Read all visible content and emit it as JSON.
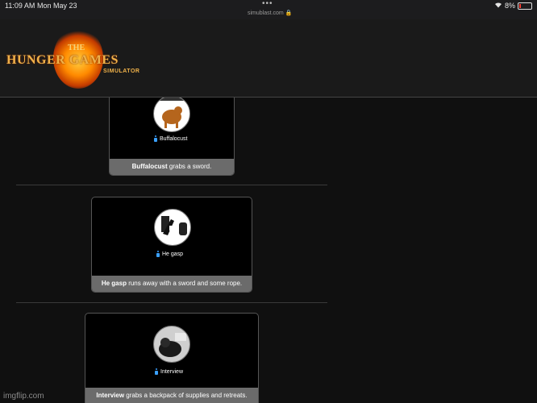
{
  "status_bar": {
    "time": "11:09 AM",
    "date": "Mon May 23",
    "url": "simublast.com",
    "battery": "8%"
  },
  "header": {
    "logo_the": "THE",
    "logo_title": "HUNGER GAMES",
    "logo_sub": "SIMULATOR"
  },
  "events": [
    {
      "name": "Buffalocust",
      "action": "grabs a sword."
    },
    {
      "name": "He gasp",
      "action": "runs away with a sword and some rope."
    },
    {
      "name": "Interview",
      "action": "grabs a backpack of supplies and retreats."
    }
  ],
  "watermark": "imgflip.com",
  "colors": {
    "page_bg": "#101010",
    "caption_bg": "#6b6b6b",
    "accent_blue": "#3aa0ff",
    "logo_orange": "#f0b24a"
  }
}
